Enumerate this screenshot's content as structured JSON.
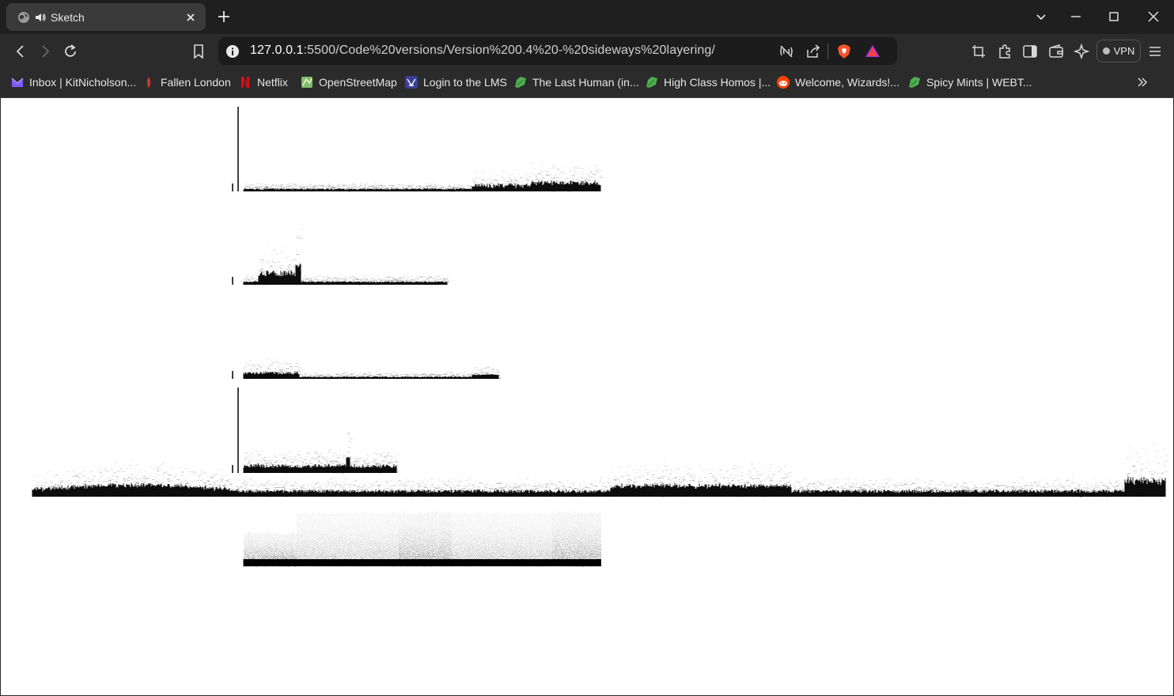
{
  "tab": {
    "title": "Sketch"
  },
  "address_bar": {
    "url_host": "127.0.0.1",
    "url_rest": ":5500/Code%20versions/Version%200.4%20-%20sideways%20layering/"
  },
  "toolbar": {
    "vpn_label": "VPN"
  },
  "bookmarks": [
    {
      "label": "Inbox | KitNicholson...",
      "icon": "proton-mail-icon",
      "color": "#7b5cff"
    },
    {
      "label": "Fallen London",
      "icon": "fallen-london-icon",
      "color": "#c0392b"
    },
    {
      "label": "Netflix",
      "icon": "netflix-icon",
      "color": "#e50914"
    },
    {
      "label": "OpenStreetMap",
      "icon": "openstreetmap-icon",
      "color": "#7ebc6f"
    },
    {
      "label": "Login to the LMS",
      "icon": "lms-icon",
      "color": "#3b3f99"
    },
    {
      "label": "The Last Human (in...",
      "icon": "leaf-icon",
      "color": "#4caf50"
    },
    {
      "label": "High Class Homos |...",
      "icon": "leaf-icon",
      "color": "#4caf50"
    },
    {
      "label": "Welcome, Wizards!...",
      "icon": "reddit-icon",
      "color": "#ff4500"
    },
    {
      "label": "Spicy Mints | WEBT...",
      "icon": "leaf-icon",
      "color": "#4caf50"
    }
  ],
  "colors": {
    "chrome_dark": "#1f1f1f",
    "toolbar": "#2b2b2b",
    "brave_orange": "#fb542b",
    "spectrogram_ink": "#000000"
  }
}
